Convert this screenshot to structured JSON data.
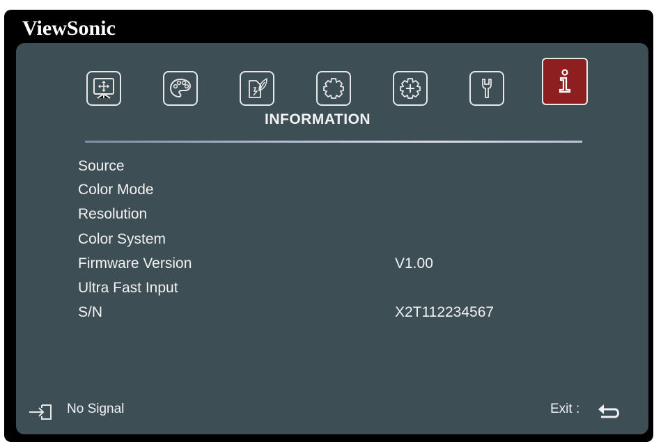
{
  "brand": "ViewSonic",
  "menu": {
    "title": "INFORMATION",
    "tabs": [
      {
        "icon": "display-icon",
        "active": false
      },
      {
        "icon": "palette-icon",
        "active": false
      },
      {
        "icon": "power-leaf-icon",
        "active": false
      },
      {
        "icon": "gear-icon",
        "active": false
      },
      {
        "icon": "advanced-gear-icon",
        "active": false
      },
      {
        "icon": "wrench-icon",
        "active": false
      },
      {
        "icon": "info-icon",
        "active": true
      }
    ]
  },
  "info_rows": [
    {
      "label": "Source",
      "value": ""
    },
    {
      "label": "Color Mode",
      "value": ""
    },
    {
      "label": "Resolution",
      "value": ""
    },
    {
      "label": "Color System",
      "value": ""
    },
    {
      "label": "Firmware Version",
      "value": "V1.00"
    },
    {
      "label": "Ultra Fast Input",
      "value": ""
    },
    {
      "label": "S/N",
      "value": "X2T112234567"
    }
  ],
  "footer": {
    "status": "No Signal",
    "exit_label": "Exit :"
  },
  "colors": {
    "panel_bg": "#3d4e55",
    "active_tab": "#8e1f21",
    "frame": "#000000",
    "text": "#f2f2f2"
  }
}
